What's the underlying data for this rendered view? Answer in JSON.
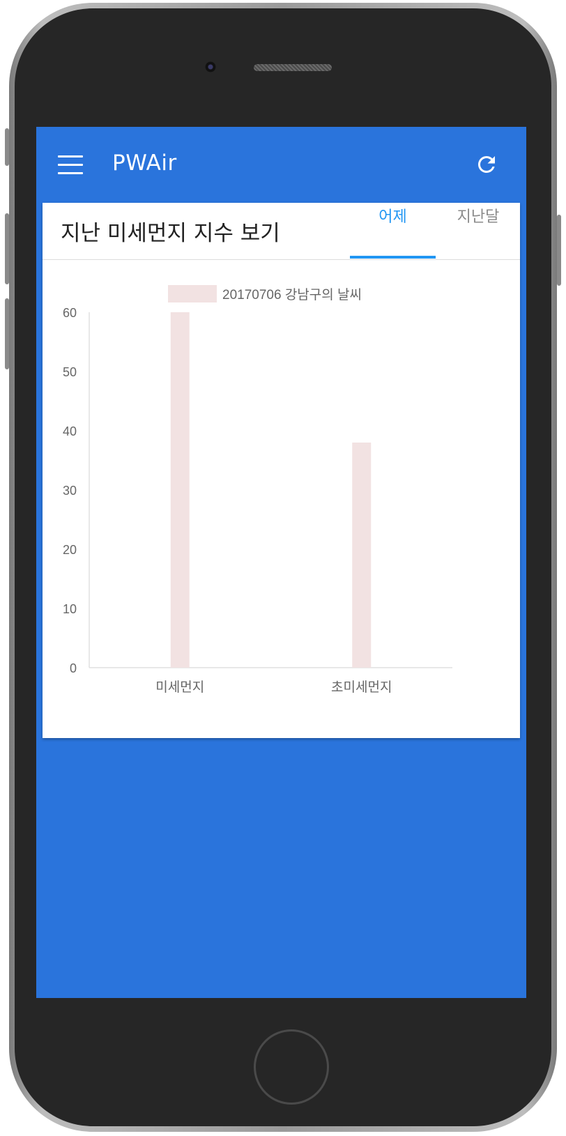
{
  "app": {
    "title": "PWAir",
    "menu_icon": "hamburger-menu-icon",
    "refresh_icon": "refresh-icon",
    "accent_color": "#2a74dc"
  },
  "card": {
    "title": "지난 미세먼지 지수 보기",
    "tabs": [
      {
        "label": "어제",
        "active": true
      },
      {
        "label": "지난달",
        "active": false
      }
    ],
    "tab_active_color": "#2196f3"
  },
  "chart_data": {
    "type": "bar",
    "categories": [
      "미세먼지",
      "초미세먼지"
    ],
    "series": [
      {
        "name": "20170706 강남구의 날씨",
        "values": [
          60,
          38
        ],
        "color": "#f2e2e2"
      }
    ],
    "ylim": [
      0,
      60
    ],
    "yticks": [
      "0",
      "10",
      "20",
      "30",
      "40",
      "50",
      "60"
    ],
    "legend_position": "top",
    "grid": false
  }
}
